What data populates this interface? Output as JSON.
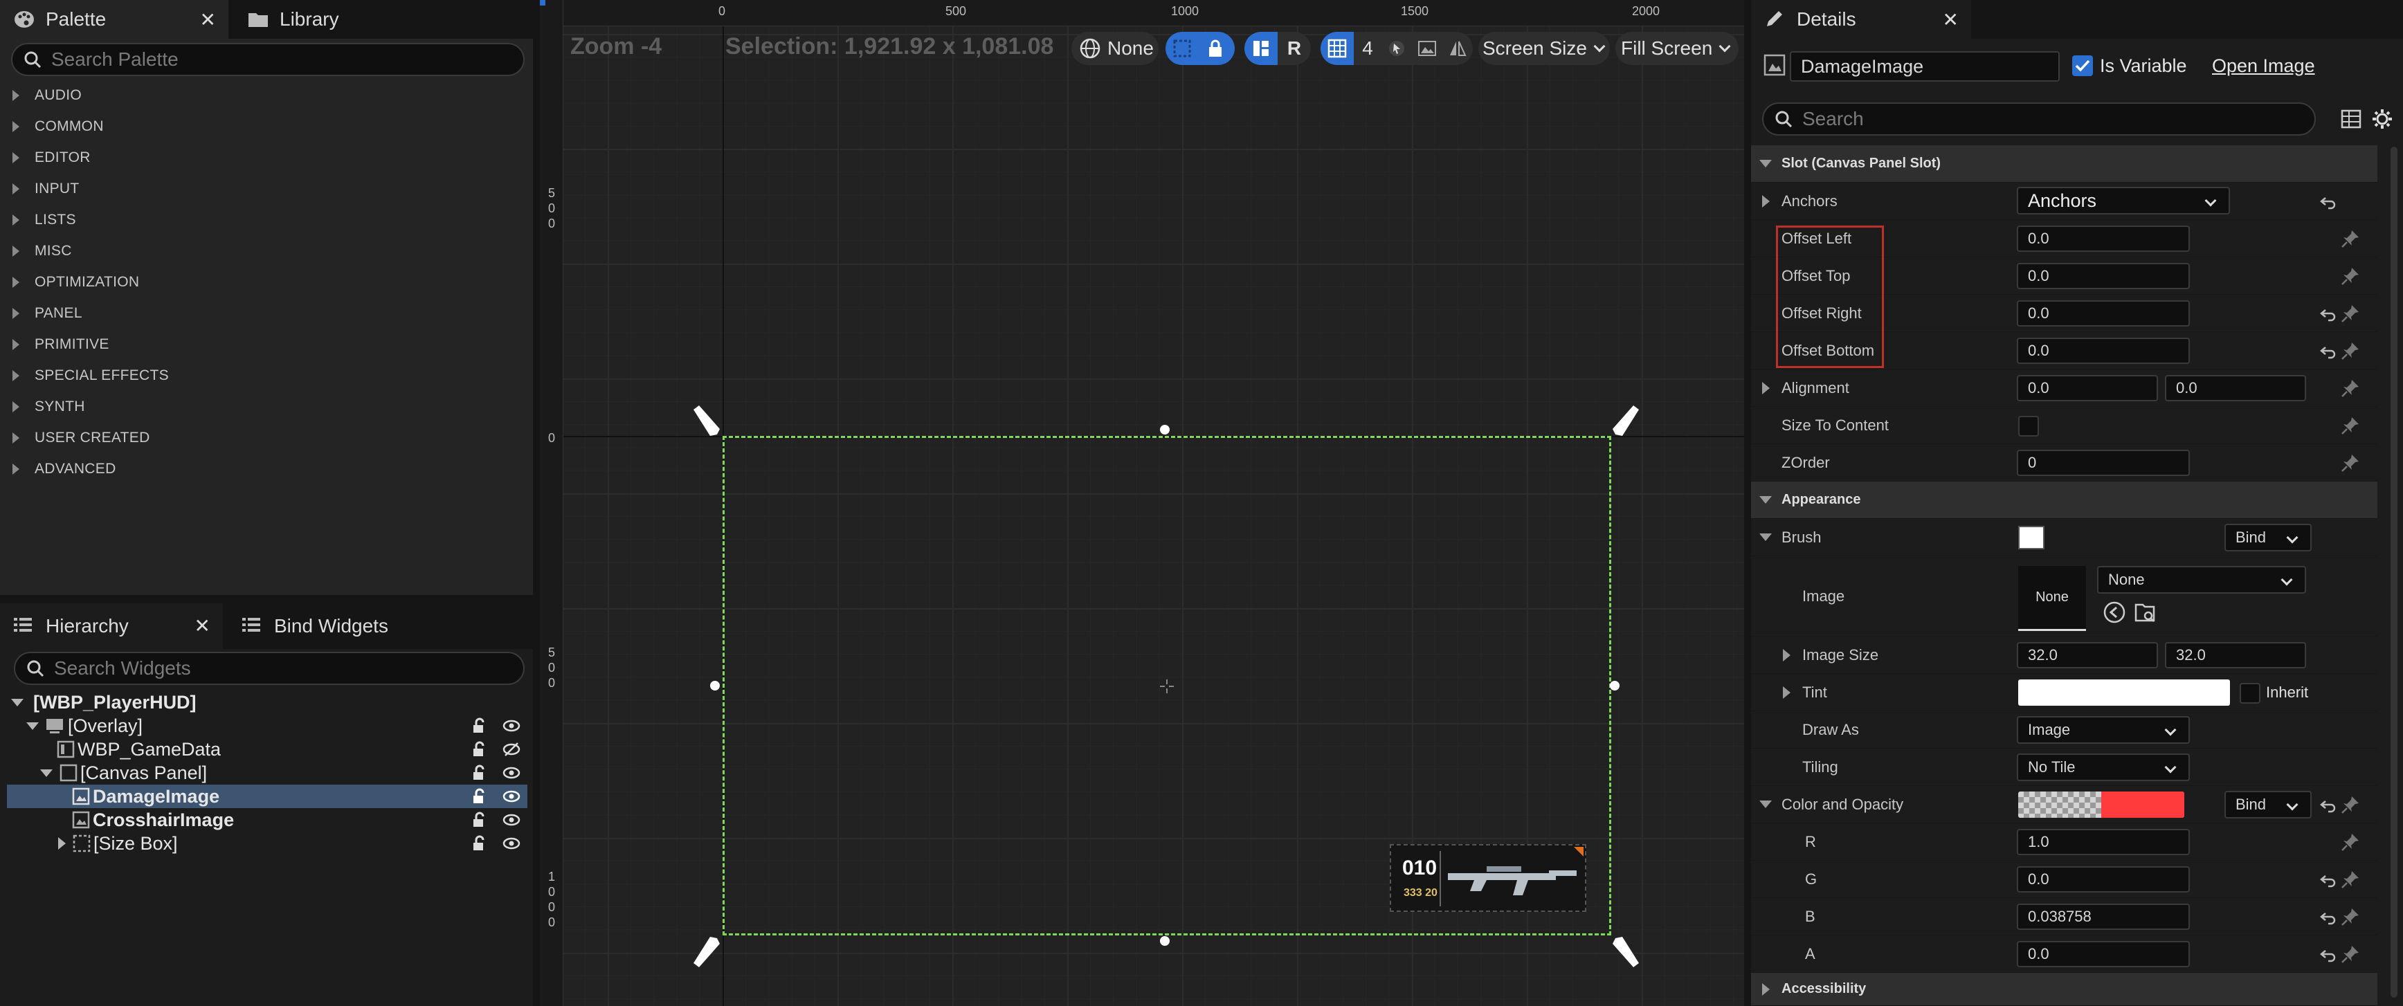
{
  "palette": {
    "tab_label": "Palette",
    "library_tab_label": "Library",
    "close_glyph": "✕",
    "search_placeholder": "Search Palette",
    "categories": [
      "AUDIO",
      "COMMON",
      "EDITOR",
      "INPUT",
      "LISTS",
      "MISC",
      "OPTIMIZATION",
      "PANEL",
      "PRIMITIVE",
      "SPECIAL EFFECTS",
      "SYNTH",
      "USER CREATED",
      "ADVANCED"
    ]
  },
  "hierarchy": {
    "tab_label": "Hierarchy",
    "bind_tab_label": "Bind Widgets",
    "close_glyph": "✕",
    "search_placeholder": "Search Widgets",
    "items": [
      {
        "label": "[WBP_PlayerHUD]"
      },
      {
        "label": "[Overlay]"
      },
      {
        "label": "WBP_GameData"
      },
      {
        "label": "[Canvas Panel]"
      },
      {
        "label": "DamageImage"
      },
      {
        "label": "CrosshairImage"
      },
      {
        "label": "[Size Box]"
      }
    ]
  },
  "viewport": {
    "zoom": "Zoom -4",
    "selection": "Selection: 1,921.92 x 1,081.08",
    "ruler_h": [
      "0",
      "500",
      "1000",
      "1500",
      "2000"
    ],
    "ruler_v_0": "0",
    "ruler_v_500a": [
      "5",
      "0",
      "0"
    ],
    "ruler_v_500b": [
      "5",
      "0",
      "0"
    ],
    "ruler_v_1000": [
      "1",
      "0",
      "0",
      "0"
    ],
    "locale_label": "None",
    "r_label": "R",
    "grid_count": "4",
    "screen_size": "Screen Size",
    "fill_screen": "Fill Screen",
    "hud_ammo": "010",
    "hud_reserve": "333 20"
  },
  "details": {
    "tab_label": "Details",
    "close_glyph": "✕",
    "name_value": "DamageImage",
    "is_variable_label": "Is Variable",
    "is_variable": true,
    "open_image_label": "Open Image",
    "search_placeholder": "Search",
    "slot_section": "Slot (Canvas Panel Slot)",
    "anchors_label": "Anchors",
    "anchors_value": "Anchors",
    "offset_left_label": "Offset Left",
    "offset_left": "0.0",
    "offset_top_label": "Offset Top",
    "offset_top": "0.0",
    "offset_right_label": "Offset Right",
    "offset_right": "0.0",
    "offset_bottom_label": "Offset Bottom",
    "offset_bottom": "0.0",
    "alignment_label": "Alignment",
    "alignment_x": "0.0",
    "alignment_y": "0.0",
    "size_to_content_label": "Size To Content",
    "zorder_label": "ZOrder",
    "zorder": "0",
    "appearance_section": "Appearance",
    "brush_label": "Brush",
    "bind_label": "Bind",
    "image_label": "Image",
    "image_preview": "None",
    "image_value": "None",
    "image_size_label": "Image Size",
    "image_size_x": "32.0",
    "image_size_y": "32.0",
    "tint_label": "Tint",
    "inherit_label": "Inherit",
    "draw_as_label": "Draw As",
    "draw_as": "Image",
    "tiling_label": "Tiling",
    "tiling": "No Tile",
    "color_label": "Color and Opacity",
    "color_bind_label": "Bind",
    "r_label": "R",
    "r_value": "1.0",
    "g_label": "G",
    "g_value": "0.0",
    "b_label": "B",
    "b_value": "0.038758",
    "a_label": "A",
    "a_value": "0.0",
    "accessibility_section": "Accessibility"
  },
  "colors": {
    "accent_blue": "#2d6fd1",
    "selection_green": "#7ed957",
    "highlight_red": "#c0302a",
    "color_opacity_red": "#ff3b3b",
    "selected_row": "#3d5571"
  }
}
